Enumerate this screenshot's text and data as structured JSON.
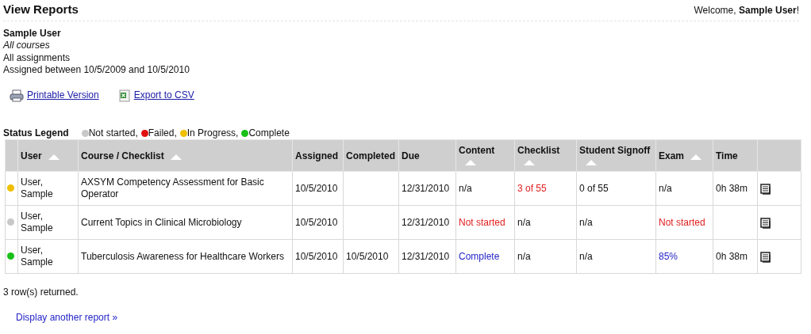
{
  "page_title": "View Reports",
  "welcome": {
    "text": "Welcome, ",
    "name": "Sample User",
    "suffix": "!"
  },
  "filters": {
    "user": "Sample User",
    "courses": "All courses",
    "assignments": "All assignments",
    "range": "Assigned between 10/5/2009 and 10/5/2010"
  },
  "actions": [
    {
      "kind": "print",
      "label": "Printable Version"
    },
    {
      "kind": "csv",
      "label": "Export to CSV"
    }
  ],
  "legend": {
    "title": "Status Legend",
    "items": [
      {
        "label": "Not started,",
        "color": "#c8c8c8"
      },
      {
        "label": "Failed,",
        "color": "#e01010"
      },
      {
        "label": "In Progress,",
        "color": "#f0c000"
      },
      {
        "label": "Complete",
        "color": "#18c018"
      }
    ]
  },
  "table": {
    "columns": [
      {
        "label": "User",
        "sortable": true
      },
      {
        "label": "Course / Checklist",
        "sortable": true
      },
      {
        "label": "Assigned",
        "sortable": false
      },
      {
        "label": "Completed",
        "sortable": false
      },
      {
        "label": "Due",
        "sortable": false
      },
      {
        "label": "Content",
        "sortable": true
      },
      {
        "label": "Checklist",
        "sortable": true
      },
      {
        "label": "Student Signoff",
        "sortable": true
      },
      {
        "label": "Exam",
        "sortable": true
      },
      {
        "label": "Time",
        "sortable": false
      }
    ],
    "rows": [
      {
        "color": "#f0c000",
        "cells": [
          {
            "text": "User, Sample"
          },
          {
            "text": "AXSYM Competency Assessment for Basic Operator"
          },
          {
            "text": "10/5/2010"
          },
          {
            "text": ""
          },
          {
            "text": "12/31/2010"
          },
          {
            "text": "n/a"
          },
          {
            "text": "3 of 55",
            "color": "#e02020"
          },
          {
            "text": "0 of 55"
          },
          {
            "text": "n/a"
          },
          {
            "text": "0h 38m"
          }
        ]
      },
      {
        "color": "#c8c8c8",
        "cells": [
          {
            "text": "User, Sample"
          },
          {
            "text": "Current Topics in Clinical Microbiology"
          },
          {
            "text": "10/5/2010"
          },
          {
            "text": ""
          },
          {
            "text": "12/31/2010"
          },
          {
            "text": "Not started",
            "color": "#e02020"
          },
          {
            "text": "n/a"
          },
          {
            "text": "n/a"
          },
          {
            "text": "Not started",
            "color": "#e02020"
          },
          {
            "text": ""
          }
        ]
      },
      {
        "color": "#18c018",
        "cells": [
          {
            "text": "User, Sample"
          },
          {
            "text": "Tuberculosis Awareness for Healthcare Workers"
          },
          {
            "text": "10/5/2010"
          },
          {
            "text": "10/5/2010"
          },
          {
            "text": "12/31/2010"
          },
          {
            "text": "Complete",
            "color": "#2424c8"
          },
          {
            "text": "n/a"
          },
          {
            "text": "n/a"
          },
          {
            "text": "85%",
            "color": "#2424c8"
          },
          {
            "text": "0h 38m"
          }
        ]
      }
    ]
  },
  "row_count": "3 row(s) returned.",
  "another_report": "Display another report »"
}
